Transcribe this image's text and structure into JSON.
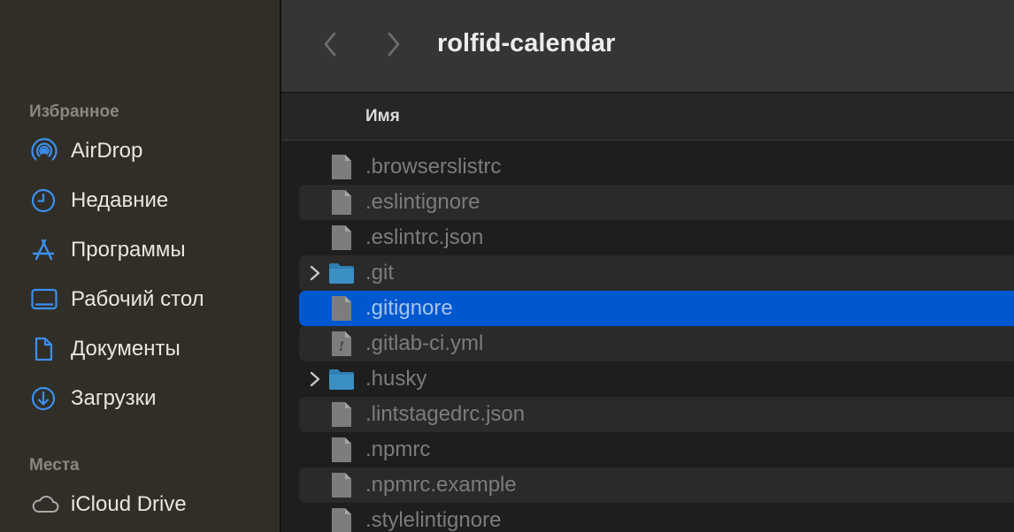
{
  "sidebar": {
    "favorites_header": "Избранное",
    "locations_header": "Места",
    "items": [
      {
        "label": "AirDrop",
        "icon": "airdrop-icon"
      },
      {
        "label": "Недавние",
        "icon": "clock-icon"
      },
      {
        "label": "Программы",
        "icon": "applications-icon"
      },
      {
        "label": "Рабочий стол",
        "icon": "desktop-icon"
      },
      {
        "label": "Документы",
        "icon": "document-icon"
      },
      {
        "label": "Загрузки",
        "icon": "downloads-icon"
      }
    ],
    "locations": [
      {
        "label": "iCloud Drive",
        "icon": "cloud-icon"
      }
    ]
  },
  "toolbar": {
    "title": "rolfid-calendar",
    "back_icon": "chevron-left-icon",
    "forward_icon": "chevron-right-icon"
  },
  "columns": {
    "name": "Имя"
  },
  "files": [
    {
      "name": ".browserslistrc",
      "type": "file"
    },
    {
      "name": ".eslintignore",
      "type": "file"
    },
    {
      "name": ".eslintrc.json",
      "type": "file"
    },
    {
      "name": ".git",
      "type": "folder"
    },
    {
      "name": ".gitignore",
      "type": "file",
      "selected": true
    },
    {
      "name": ".gitlab-ci.yml",
      "type": "yaml"
    },
    {
      "name": ".husky",
      "type": "folder"
    },
    {
      "name": ".lintstagedrc.json",
      "type": "file"
    },
    {
      "name": ".npmrc",
      "type": "file"
    },
    {
      "name": ".npmrc.example",
      "type": "file"
    },
    {
      "name": ".stylelintignore",
      "type": "file"
    }
  ],
  "colors": {
    "accent": "#0058d0",
    "sidebar_icon": "#3c8ff0",
    "folder": "#3b8fc3"
  }
}
